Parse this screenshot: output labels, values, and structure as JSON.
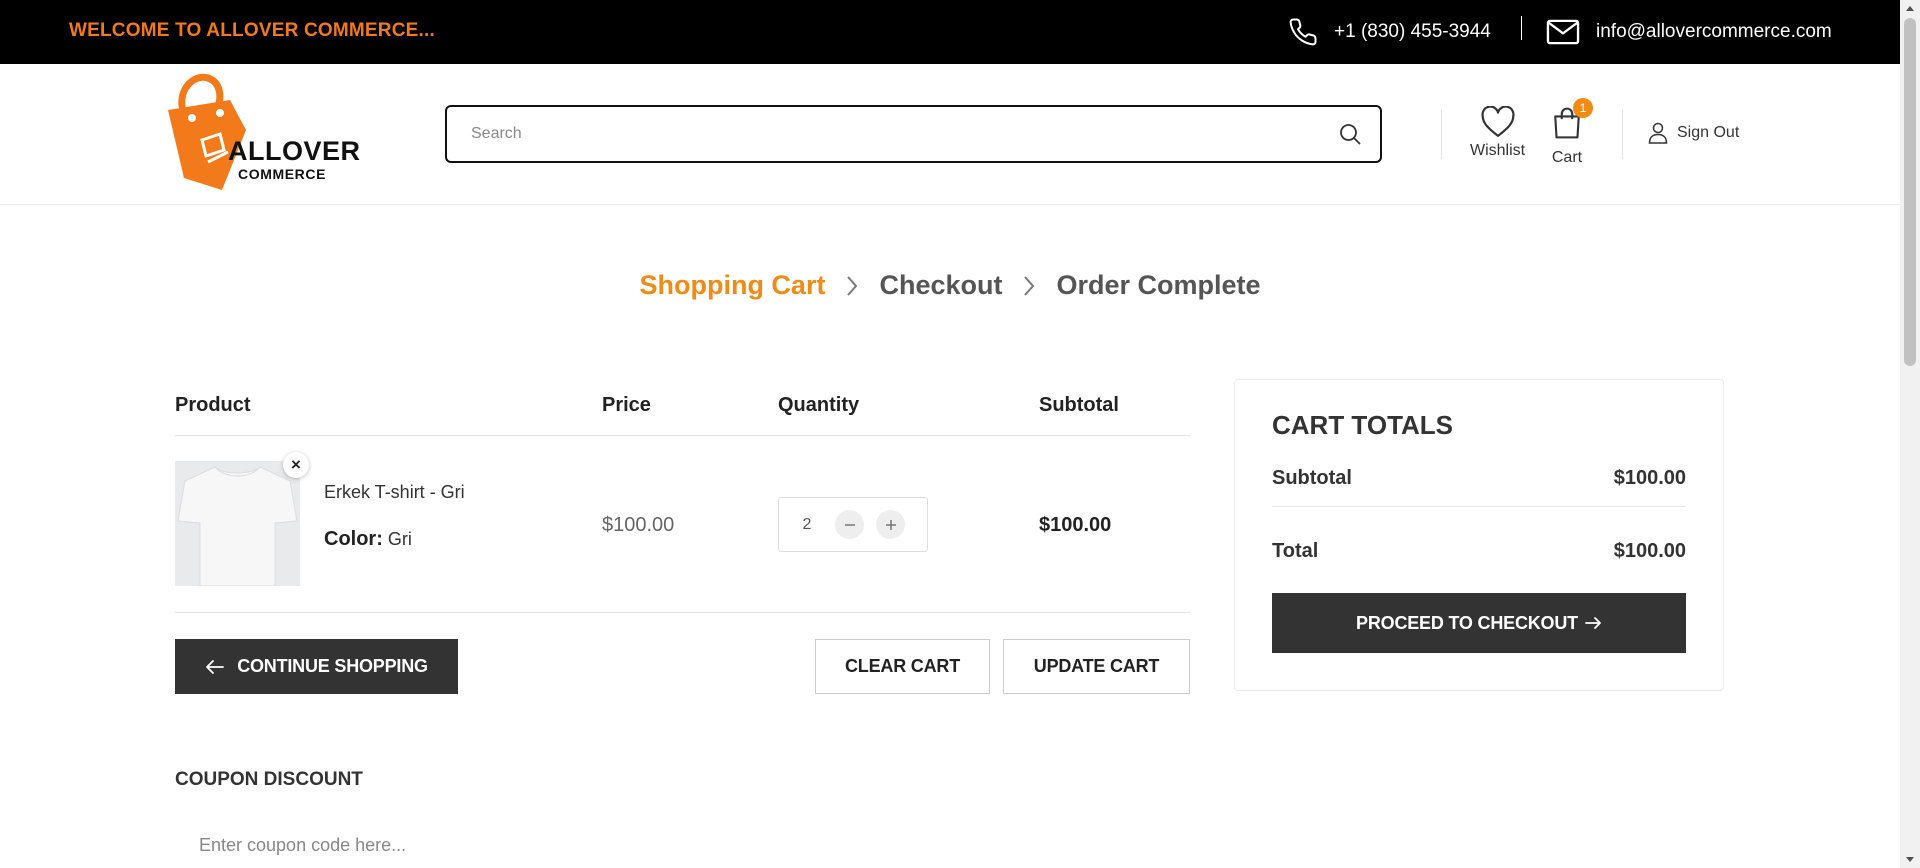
{
  "topbar": {
    "welcome": "WELCOME TO ALLOVER COMMERCE...",
    "phone": "+1 (830) 455-3944",
    "email": "info@allovercommerce.com"
  },
  "header": {
    "logo": {
      "line1": "ALLOVER",
      "line2": "COMMERCE"
    },
    "search_placeholder": "Search",
    "wishlist_label": "Wishlist",
    "cart_label": "Cart",
    "cart_count": "1",
    "signout_label": "Sign Out"
  },
  "steps": [
    {
      "label": "Shopping Cart",
      "active": true
    },
    {
      "label": "Checkout",
      "active": false
    },
    {
      "label": "Order Complete",
      "active": false
    }
  ],
  "cart_table": {
    "headers": {
      "product": "Product",
      "price": "Price",
      "quantity": "Quantity",
      "subtotal": "Subtotal"
    },
    "items": [
      {
        "name": "Erkek T-shirt - Gri",
        "color_label": "Color:",
        "color_value": "Gri",
        "price": "$100.00",
        "quantity": "2",
        "subtotal": "$100.00",
        "remove_glyph": "×"
      }
    ]
  },
  "actions": {
    "continue_shopping": "CONTINUE SHOPPING",
    "clear_cart": "CLEAR CART",
    "update_cart": "UPDATE CART"
  },
  "coupon": {
    "title": "COUPON DISCOUNT",
    "placeholder": "Enter coupon code here..."
  },
  "totals": {
    "title": "CART TOTALS",
    "subtotal_label": "Subtotal",
    "subtotal_value": "$100.00",
    "total_label": "Total",
    "total_value": "$100.00",
    "checkout_label": "PROCEED TO CHECKOUT"
  },
  "colors": {
    "accent": "#f28a16",
    "dark_button": "#333333",
    "topbar_bg": "#000000"
  },
  "icons": {
    "phone": "phone-icon",
    "mail": "mail-icon",
    "search": "search-icon",
    "wishlist": "heart-icon",
    "cart": "bag-icon",
    "user": "user-icon"
  }
}
